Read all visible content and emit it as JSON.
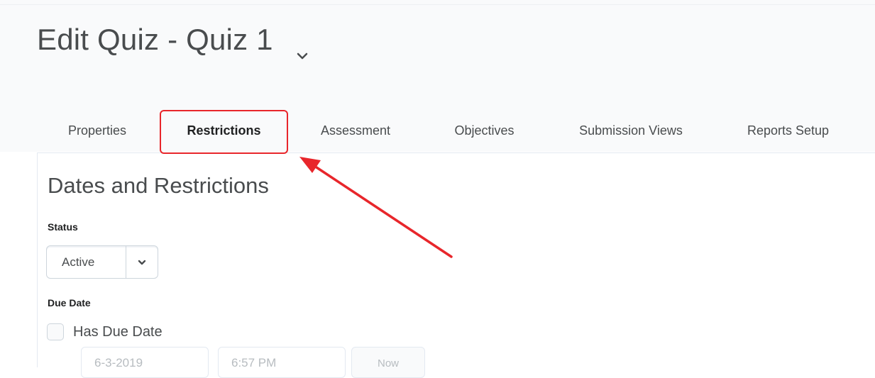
{
  "header": {
    "title": "Edit Quiz - Quiz 1"
  },
  "tabs": [
    {
      "label": "Properties",
      "active": false
    },
    {
      "label": "Restrictions",
      "active": true
    },
    {
      "label": "Assessment",
      "active": false
    },
    {
      "label": "Objectives",
      "active": false
    },
    {
      "label": "Submission Views",
      "active": false
    },
    {
      "label": "Reports Setup",
      "active": false
    }
  ],
  "section": {
    "title": "Dates and Restrictions"
  },
  "status": {
    "label": "Status",
    "value": "Active"
  },
  "due_date": {
    "label": "Due Date",
    "checkbox_label": "Has Due Date",
    "checked": false,
    "date_value": "6-3-2019",
    "time_value": "6:57 PM",
    "now_label": "Now"
  },
  "colors": {
    "annotation": "#e8262b",
    "text": "#494c4e"
  }
}
